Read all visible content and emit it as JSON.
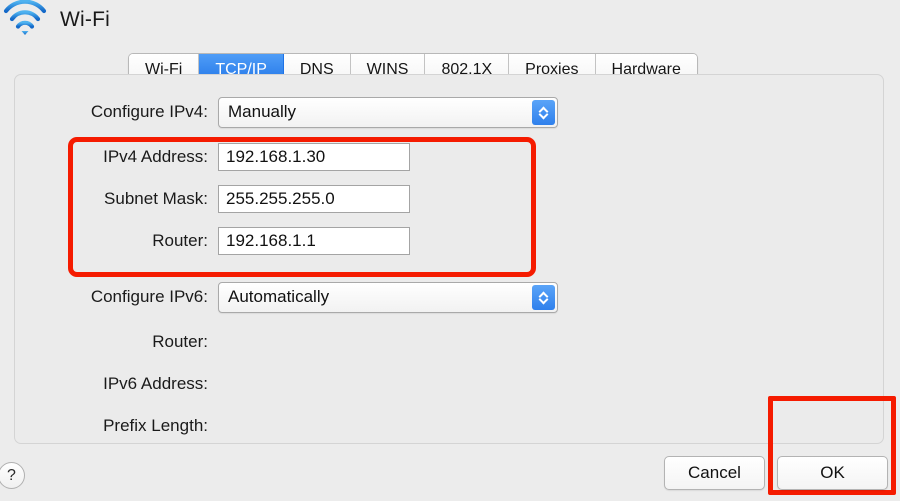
{
  "window": {
    "title": "Wi-Fi",
    "wifi_icon": "wifi-icon"
  },
  "tabs": [
    {
      "label": "Wi-Fi",
      "selected": false
    },
    {
      "label": "TCP/IP",
      "selected": true
    },
    {
      "label": "DNS",
      "selected": false
    },
    {
      "label": "WINS",
      "selected": false
    },
    {
      "label": "802.1X",
      "selected": false
    },
    {
      "label": "Proxies",
      "selected": false
    },
    {
      "label": "Hardware",
      "selected": false
    }
  ],
  "ipv4": {
    "configure_label": "Configure IPv4:",
    "configure_value": "Manually",
    "address_label": "IPv4 Address:",
    "address_value": "192.168.1.30",
    "subnet_label": "Subnet Mask:",
    "subnet_value": "255.255.255.0",
    "router_label": "Router:",
    "router_value": "192.168.1.1"
  },
  "ipv6": {
    "configure_label": "Configure IPv6:",
    "configure_value": "Automatically",
    "router_label": "Router:",
    "router_value": "",
    "address_label": "IPv6 Address:",
    "address_value": "",
    "prefix_label": "Prefix Length:",
    "prefix_value": ""
  },
  "footer": {
    "help_label": "?",
    "cancel_label": "Cancel",
    "ok_label": "OK"
  },
  "annotations": {
    "color": "#f51b00",
    "ipv4_box": "highlight-ipv4-fields",
    "ok_box": "highlight-ok-button"
  },
  "colors": {
    "accent_blue": "#2f80ec",
    "tab_selected_top": "#4f9df7",
    "tab_selected_bottom": "#1f73e6",
    "window_background": "#ececec"
  }
}
